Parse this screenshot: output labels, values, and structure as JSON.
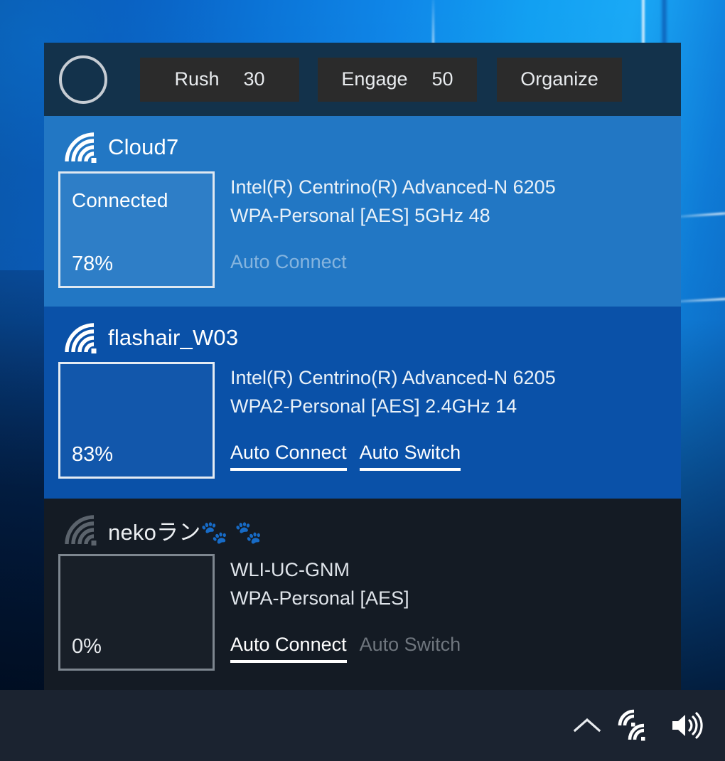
{
  "header": {
    "mode_toggle": "mode-circle",
    "buttons": [
      {
        "label": "Rush",
        "value": "30"
      },
      {
        "label": "Engage",
        "value": "50"
      },
      {
        "label": "Organize",
        "value": ""
      }
    ]
  },
  "networks": [
    {
      "ssid": "Cloud7",
      "status": "Connected",
      "percent": "78%",
      "adapter": "Intel(R) Centrino(R) Advanced-N 6205",
      "security": "WPA-Personal [AES] 5GHz 48",
      "actions": [
        {
          "label": "Auto Connect",
          "state": "off"
        }
      ],
      "signal_state": "strong"
    },
    {
      "ssid": "flashair_W03",
      "status": "",
      "percent": "83%",
      "adapter": "Intel(R) Centrino(R) Advanced-N 6205",
      "security": "WPA2-Personal [AES] 2.4GHz 14",
      "actions": [
        {
          "label": "Auto Connect",
          "state": "on"
        },
        {
          "label": "Auto Switch",
          "state": "on"
        }
      ],
      "signal_state": "strong"
    },
    {
      "ssid": "nekoラン🐾 🐾",
      "status": "",
      "percent": "0%",
      "adapter": "WLI-UC-GNM",
      "security": "WPA-Personal [AES]",
      "actions": [
        {
          "label": "Auto Connect",
          "state": "on"
        },
        {
          "label": "Auto Switch",
          "state": "off"
        }
      ],
      "signal_state": "none"
    }
  ],
  "taskbar": {
    "items": [
      {
        "icon": "chevron-up-icon"
      },
      {
        "icon": "network-icon"
      },
      {
        "icon": "volume-icon"
      }
    ]
  },
  "colors": {
    "header_bar": "#13324b",
    "header_button": "#2b2b2b",
    "row_connected": "#2277c4",
    "row_selected": "#0a51a8",
    "row_inactive": "#141b24",
    "taskbar": "#1b2330",
    "accent_text": "#ffffff"
  }
}
